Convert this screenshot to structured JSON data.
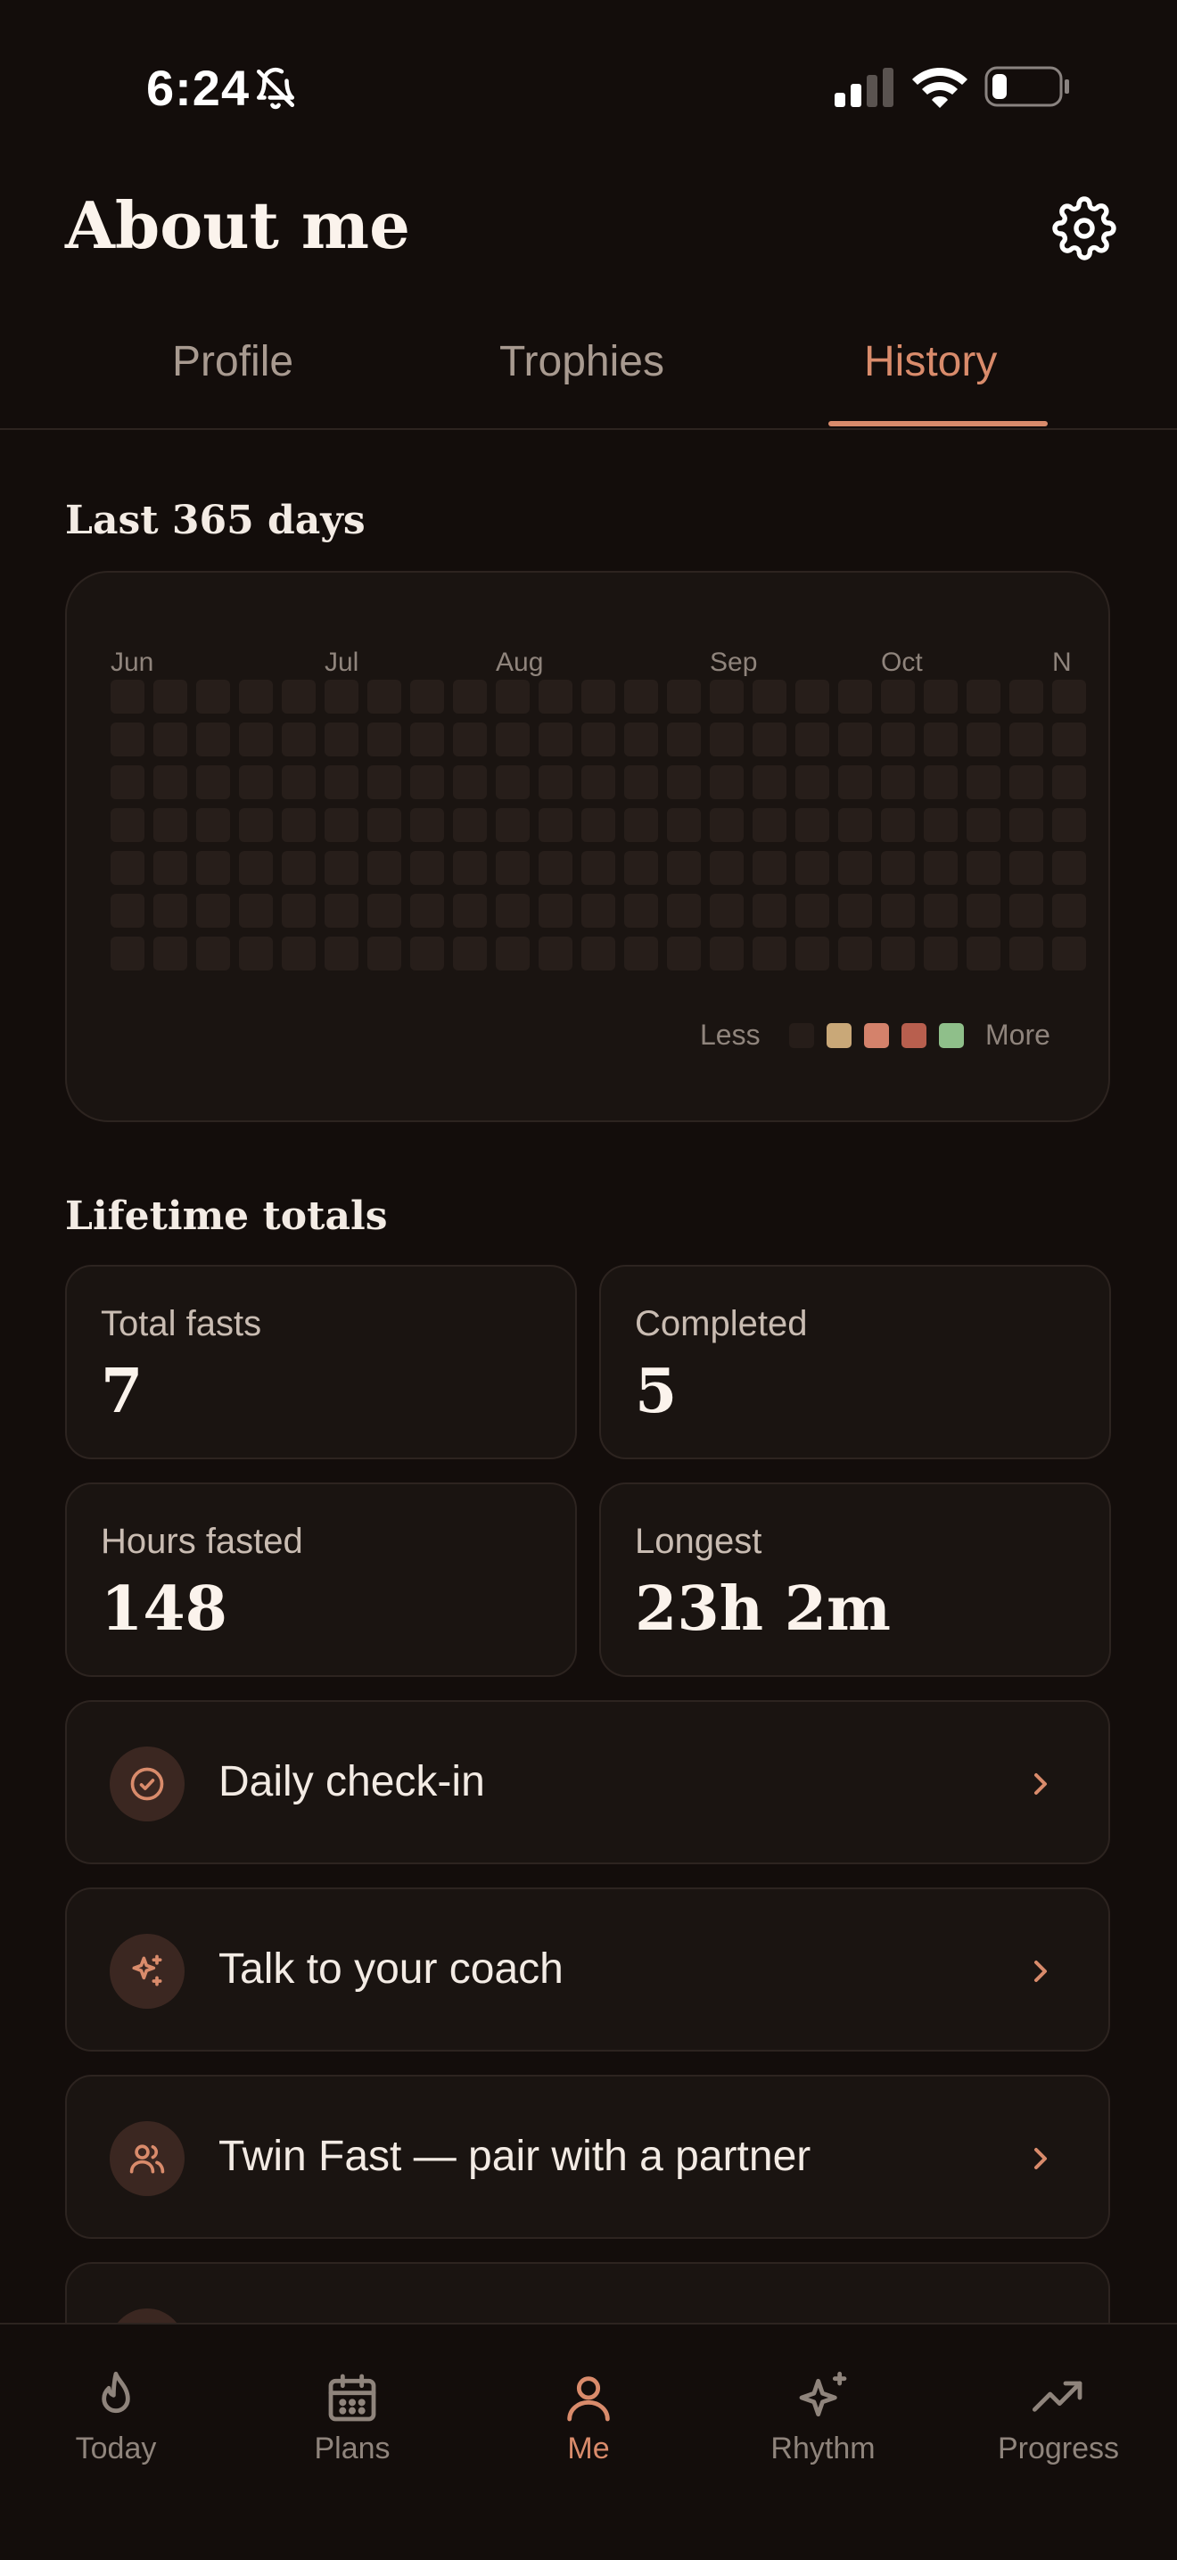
{
  "status_bar": {
    "time": "6:24"
  },
  "header": {
    "title": "About me"
  },
  "tabs": [
    {
      "label": "Profile",
      "active": false
    },
    {
      "label": "Trophies",
      "active": false
    },
    {
      "label": "History",
      "active": true
    }
  ],
  "history": {
    "heatmap_title": "Last 365 days",
    "months": [
      "Jun",
      "Jul",
      "Aug",
      "Sep",
      "Oct",
      "N"
    ],
    "legend": {
      "less": "Less",
      "more": "More",
      "colors": [
        "#261d19",
        "#c9a878",
        "#d4826b",
        "#b85f4e",
        "#8fbf8a"
      ]
    },
    "empty_cell_color": "#271e1a"
  },
  "lifetime": {
    "title": "Lifetime totals",
    "stats": [
      {
        "label": "Total fasts",
        "value": "7"
      },
      {
        "label": "Completed",
        "value": "5"
      },
      {
        "label": "Hours fasted",
        "value": "148"
      },
      {
        "label": "Longest",
        "value": "23h 2m"
      }
    ]
  },
  "actions": [
    {
      "label": "Daily check-in",
      "icon": "check-circle-icon"
    },
    {
      "label": "Talk to your coach",
      "icon": "sparkle-icon"
    },
    {
      "label": "Twin Fast — pair with a partner",
      "icon": "users-icon"
    }
  ],
  "bottom_nav": [
    {
      "label": "Today",
      "icon": "flame-icon",
      "active": false
    },
    {
      "label": "Plans",
      "icon": "calendar-icon",
      "active": false
    },
    {
      "label": "Me",
      "icon": "user-icon",
      "active": true
    },
    {
      "label": "Rhythm",
      "icon": "sparkles-icon",
      "active": false
    },
    {
      "label": "Progress",
      "icon": "trending-up-icon",
      "active": false
    }
  ],
  "colors": {
    "background": "#130d0b",
    "card": "#1a1411",
    "border": "#2d2420",
    "accent": "#d98b6b",
    "muted_text": "#8f847c"
  }
}
